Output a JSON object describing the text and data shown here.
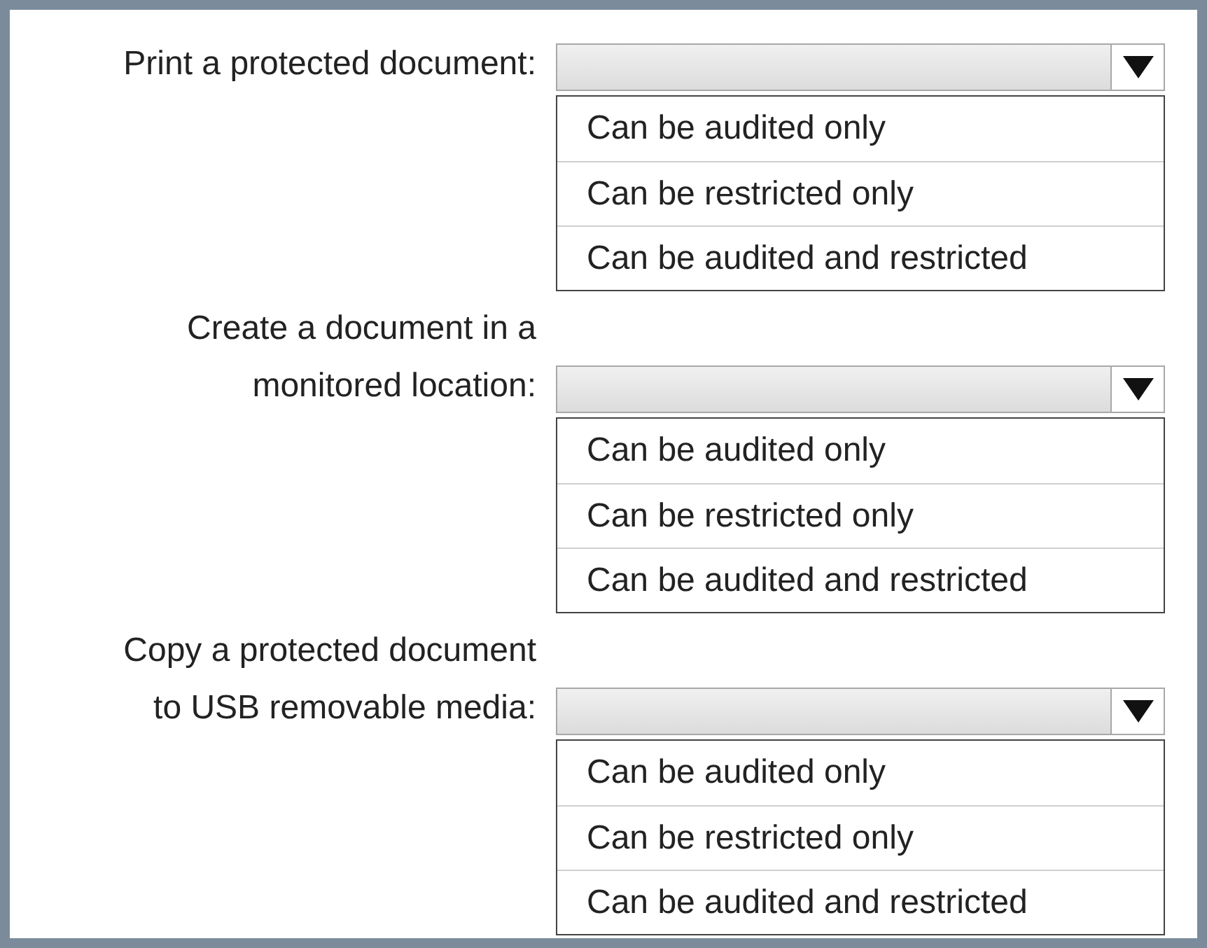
{
  "questions": [
    {
      "label_lines": [
        "Print a protected document:"
      ],
      "options": [
        "Can be audited only",
        "Can be restricted only",
        "Can be audited and restricted"
      ]
    },
    {
      "label_lines": [
        "Create a document in a",
        "monitored location:"
      ],
      "options": [
        "Can be audited only",
        "Can be restricted only",
        "Can be audited and restricted"
      ]
    },
    {
      "label_lines": [
        "Copy a protected document",
        "to USB removable media:"
      ],
      "options": [
        "Can be audited only",
        "Can be restricted only",
        "Can be audited and restricted"
      ]
    }
  ]
}
